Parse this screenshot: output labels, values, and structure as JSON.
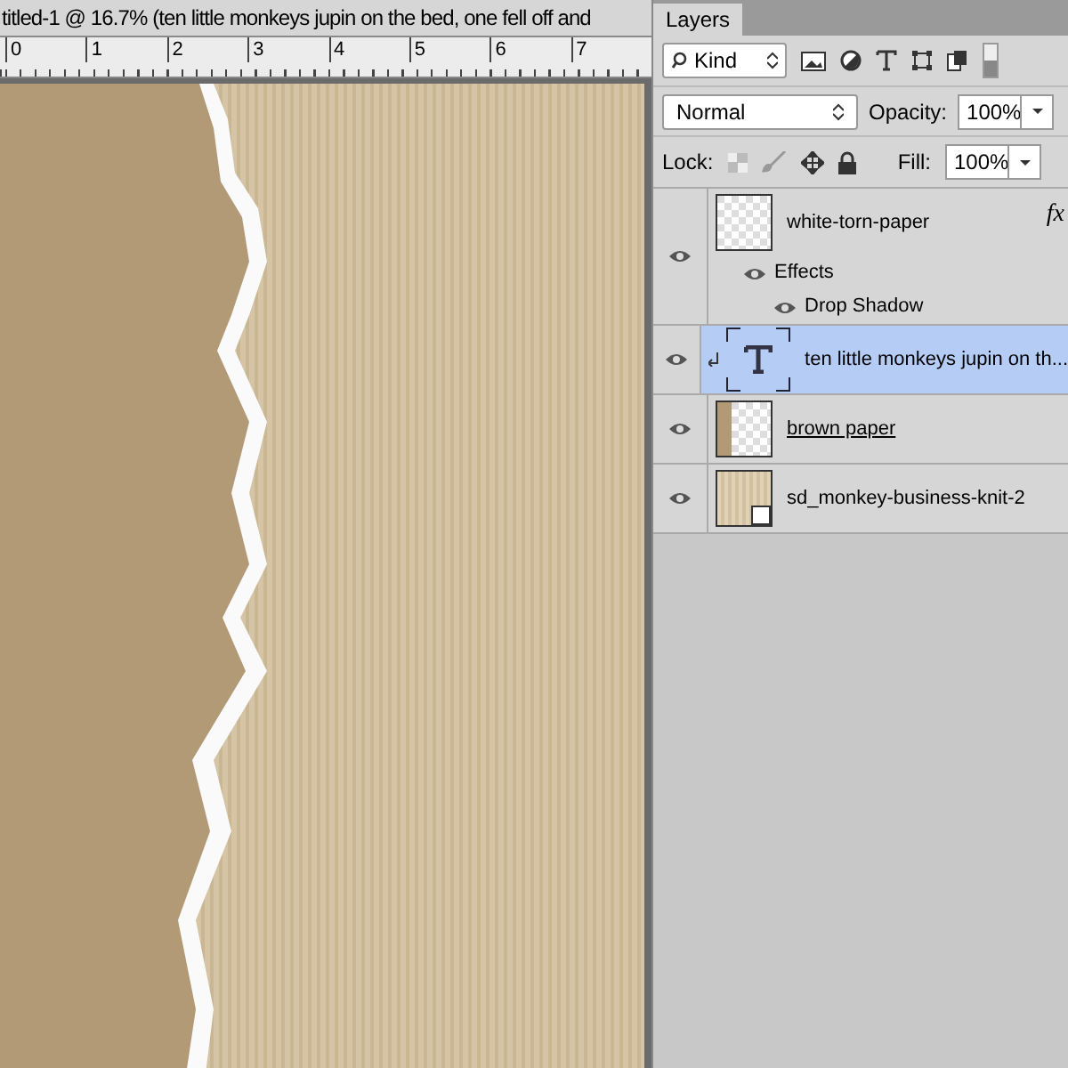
{
  "document": {
    "title": "titled-1 @ 16.7% (ten little monkeys jupin on the bed, one fell off and",
    "ruler": [
      "0",
      "1",
      "2",
      "3",
      "4",
      "5",
      "6",
      "7"
    ]
  },
  "layers_panel": {
    "tab": "Layers",
    "filter": "Kind",
    "blend_mode": "Normal",
    "opacity_label": "Opacity:",
    "opacity": "100%",
    "lock_label": "Lock:",
    "fill_label": "Fill:",
    "fill": "100%",
    "layers": [
      {
        "name": "white-torn-paper",
        "kind": "torn",
        "visible": true,
        "selected": false,
        "underlined": false,
        "fx": "fx",
        "effects_label": "Effects",
        "effects": [
          "Drop Shadow"
        ]
      },
      {
        "name": "ten little monkeys jupin on th...",
        "kind": "text",
        "visible": true,
        "selected": true,
        "underlined": false,
        "clipped": true
      },
      {
        "name": "brown paper",
        "kind": "brown",
        "visible": true,
        "selected": false,
        "underlined": true
      },
      {
        "name": "sd_monkey-business-knit-2",
        "kind": "smart",
        "visible": true,
        "selected": false,
        "underlined": false
      }
    ]
  }
}
